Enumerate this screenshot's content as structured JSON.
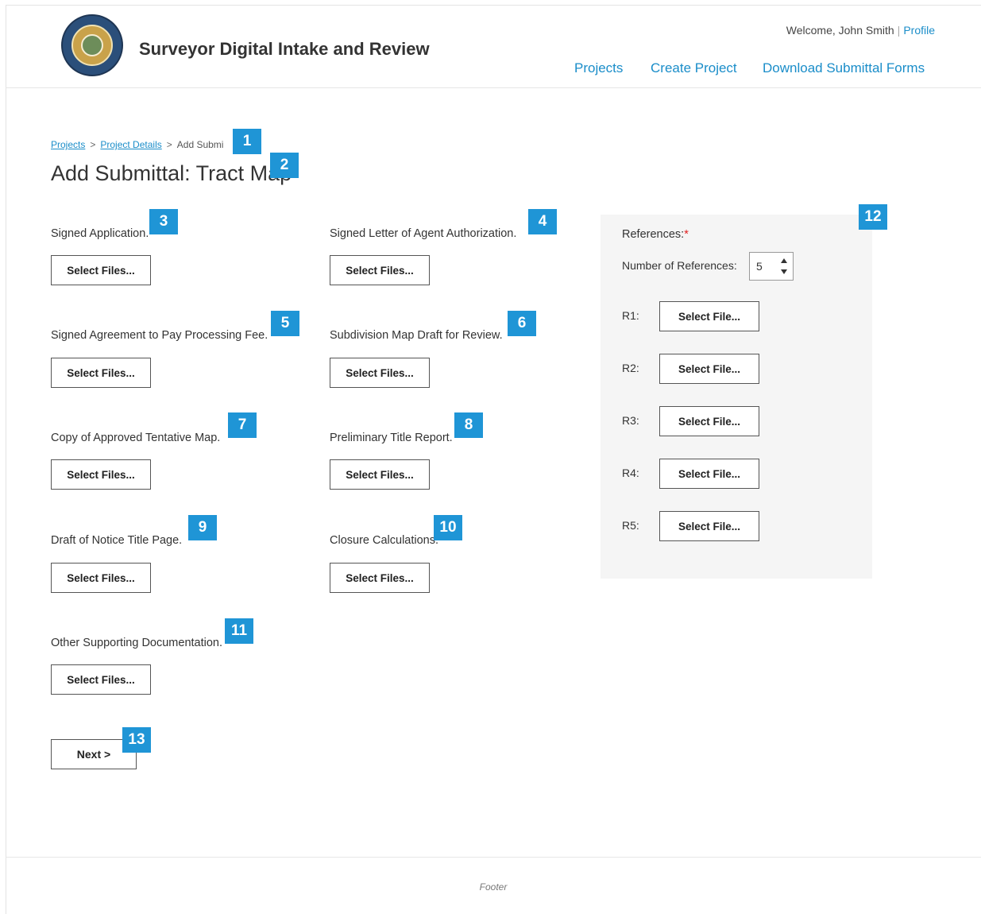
{
  "header": {
    "app_title": "Surveyor Digital Intake and Review",
    "logo_alt": "County of Santa Barbara California",
    "welcome": "Welcome, John Smith",
    "separator": "|",
    "profile_link": "Profile",
    "nav": [
      "Projects",
      "Create Project",
      "Download Submittal Forms"
    ]
  },
  "breadcrumb": {
    "items": [
      "Projects",
      "Project Details"
    ],
    "separator": ">",
    "current": "Add Submi"
  },
  "page_title": "Add Submittal: Tract Map",
  "fields": [
    {
      "label": "Signed Application.",
      "button": "Select Files..."
    },
    {
      "label": "Signed Letter of Agent Authorization.",
      "button": "Select Files..."
    },
    {
      "label": "Signed Agreement to Pay Processing Fee.",
      "button": "Select Files..."
    },
    {
      "label": "Subdivision Map Draft for Review.",
      "button": "Select Files..."
    },
    {
      "label": "Copy of Approved Tentative Map.",
      "button": "Select Files..."
    },
    {
      "label": "Preliminary Title Report.",
      "button": "Select Files..."
    },
    {
      "label": "Draft of  Notice Title Page.",
      "button": "Select Files..."
    },
    {
      "label": "Closure Calculations.",
      "button": "Select Files..."
    },
    {
      "label": "Other Supporting Documentation.",
      "button": "Select Files..."
    }
  ],
  "references": {
    "label": "References:",
    "required_mark": "*",
    "count_label": "Number of References:",
    "count_value": "5",
    "items": [
      {
        "label": "R1:",
        "button": "Select File..."
      },
      {
        "label": "R2:",
        "button": "Select File..."
      },
      {
        "label": "R3:",
        "button": "Select File..."
      },
      {
        "label": "R4:",
        "button": "Select File..."
      },
      {
        "label": "R5:",
        "button": "Select File..."
      }
    ]
  },
  "next_button": "Next >",
  "footer": "Footer",
  "badges": [
    "1",
    "2",
    "3",
    "4",
    "5",
    "6",
    "7",
    "8",
    "9",
    "10",
    "11",
    "12",
    "13"
  ],
  "colors": {
    "link": "#1a8dc9",
    "badge": "#1f95d6",
    "required": "#e02020",
    "panel": "#f5f5f5"
  }
}
